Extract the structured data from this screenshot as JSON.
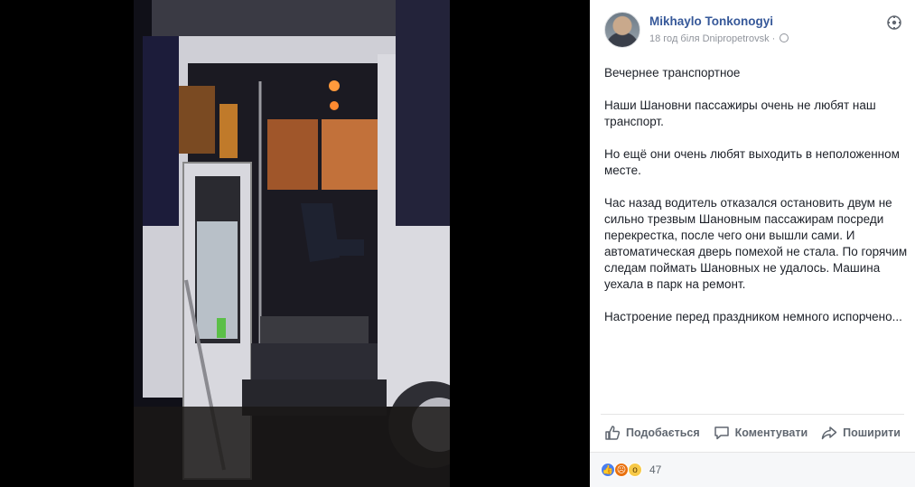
{
  "post": {
    "author": "Mikhaylo Tonkonogyi",
    "meta": "18 год біля Dnipropetrovsk ·",
    "paragraphs": [
      "Вечернее транспортное",
      "Наши Шановни пассажиры очень не любят наш транспорт.",
      "Но ещё они очень любят выходить в неположенном месте.",
      "Час назад водитель отказался остановить двум не сильно трезвым Шановным пассажирам посреди перекрестка, после чего они вышли сами. И автоматическая дверь помехой не стала. По горячим следам поймать Шановных не удалось. Машина уехала в парк на ремонт.",
      "Настроение перед праздником немного испорчено..."
    ]
  },
  "actions": {
    "like": "Подобається",
    "comment": "Коментувати",
    "share": "Поширити"
  },
  "reactions": {
    "count": "47",
    "icons": [
      "like-icon",
      "angry-icon",
      "wow-icon"
    ]
  },
  "icons": {
    "more": "more-options-icon",
    "globe": "globe-icon"
  },
  "colors": {
    "author_link": "#365899",
    "meta_text": "#90949c",
    "body_text": "#1d2129",
    "action_text": "#606770",
    "reaction_like": "#4a7ff0",
    "reaction_angry": "#e9710f",
    "reaction_wow": "#f7c948"
  }
}
